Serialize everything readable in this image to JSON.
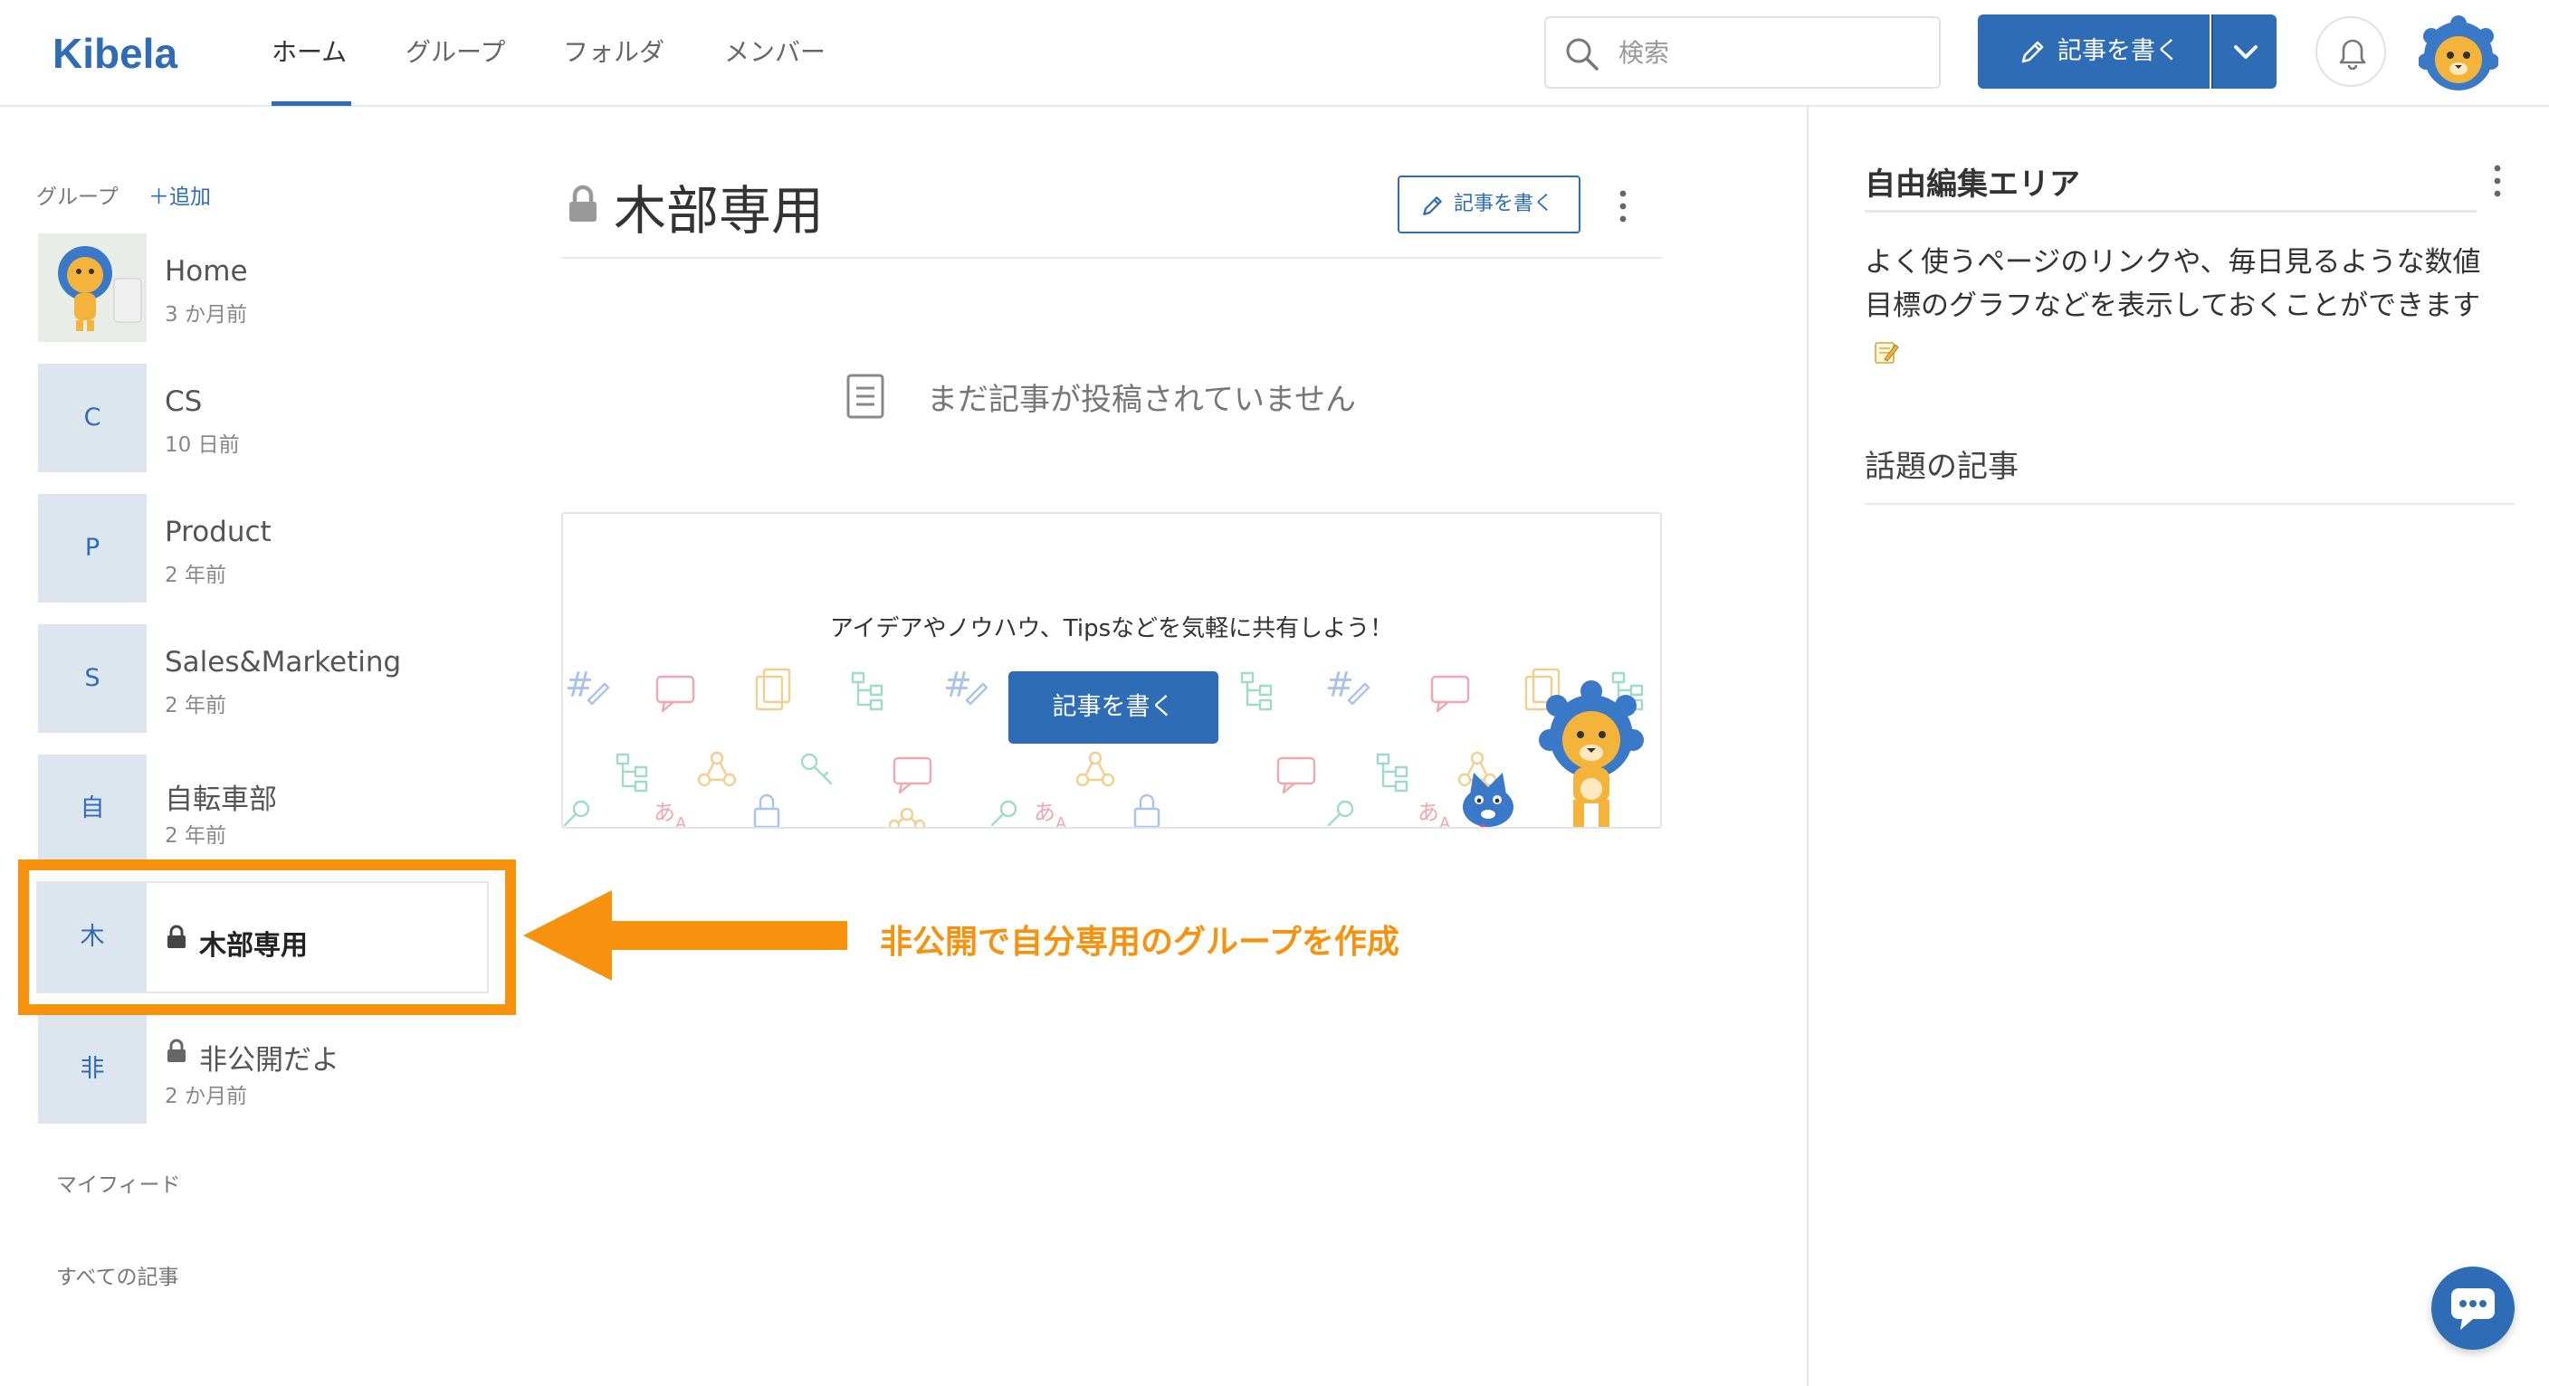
{
  "header": {
    "logo": "Kibela",
    "tabs": [
      {
        "label": "ホーム",
        "active": true
      },
      {
        "label": "グループ",
        "active": false
      },
      {
        "label": "フォルダ",
        "active": false
      },
      {
        "label": "メンバー",
        "active": false
      }
    ],
    "search_placeholder": "検索",
    "write_button_label": "記事を書く"
  },
  "sidebar": {
    "heading": "グループ",
    "add_label": "＋追加",
    "groups": [
      {
        "initial": "",
        "name": "Home",
        "updated": "3 か月前"
      },
      {
        "initial": "C",
        "name": "CS",
        "updated": "10 日前"
      },
      {
        "initial": "P",
        "name": "Product",
        "updated": "2 年前"
      },
      {
        "initial": "S",
        "name": "Sales&Marketing",
        "updated": "2 年前"
      },
      {
        "initial": "自",
        "name": "自転車部",
        "updated": "2 年前"
      },
      {
        "initial": "木",
        "name": "木部専用",
        "updated": "",
        "private": true,
        "selected": true
      },
      {
        "initial": "非",
        "name": "非公開だよ",
        "updated": "2 か月前",
        "private": true
      }
    ],
    "my_feed": "マイフィード",
    "all_articles": "すべての記事"
  },
  "annotation": {
    "text": "非公開で自分専用のグループを作成",
    "color": "#f7920f"
  },
  "main": {
    "title": "木部専用",
    "write_button_label": "記事を書く",
    "empty_message": "まだ記事が投稿されていません",
    "promo_text": "アイデアやノウハウ、Tipsなどを気軽に共有しよう！",
    "promo_button_label": "記事を書く"
  },
  "right_panel": {
    "title": "自由編集エリア",
    "body": "よく使うページのリンクや、毎日見るような数値目標のグラフなどを表示しておくことができます",
    "trending_title": "話題の記事"
  },
  "colors": {
    "brand": "#2e6db5",
    "accent": "#f7920f",
    "tile": "#dde5ef"
  }
}
